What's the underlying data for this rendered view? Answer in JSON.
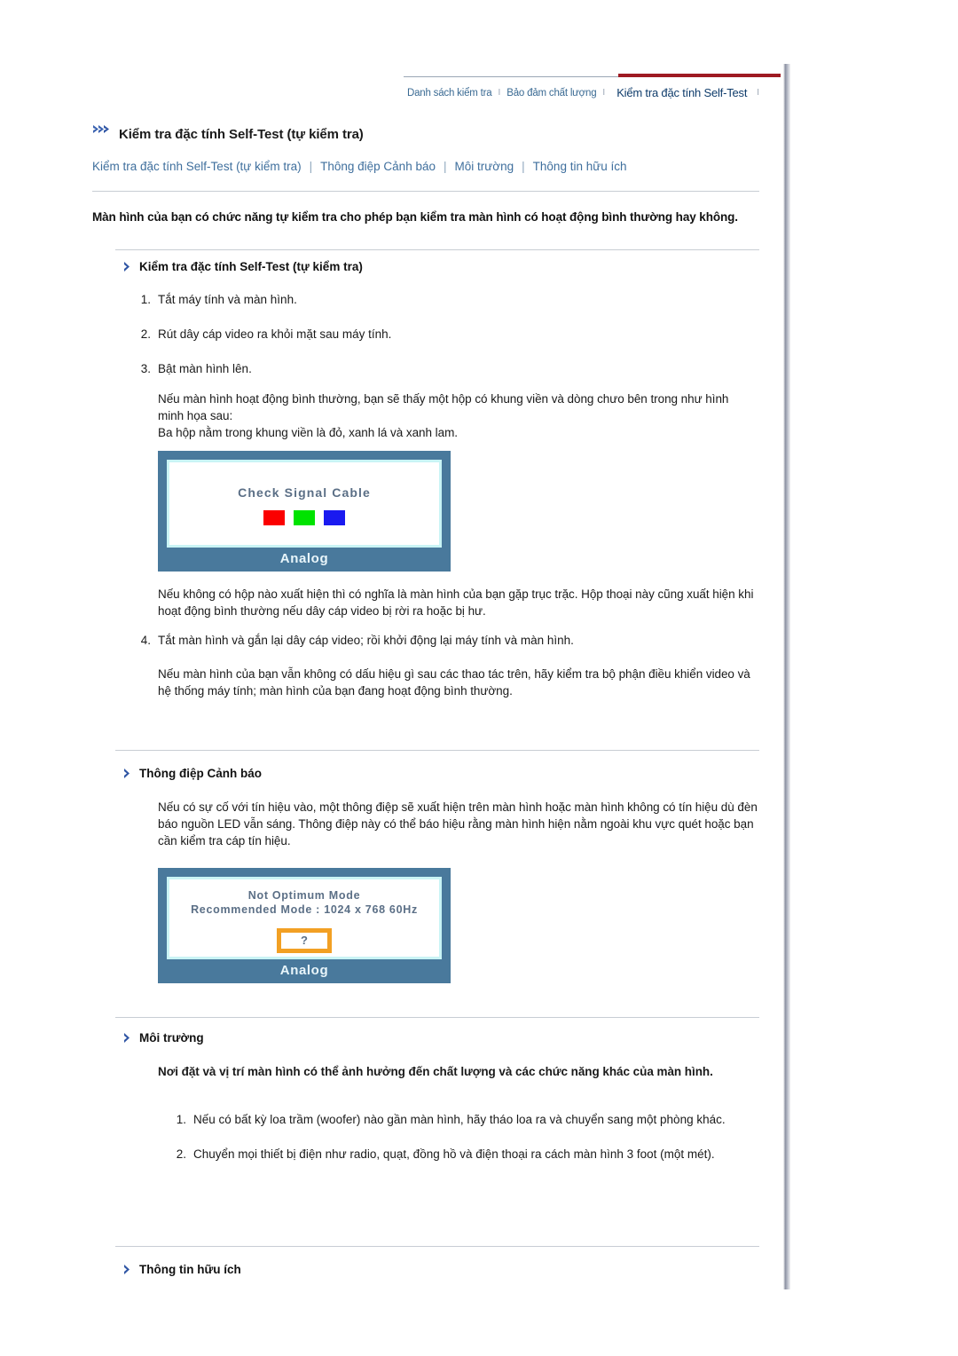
{
  "topnav": {
    "items": [
      {
        "label": "Danh sách kiểm tra",
        "active": false
      },
      {
        "label": "Bảo đảm chất lượng",
        "active": false
      },
      {
        "label": "Kiểm tra đặc tính Self-Test",
        "active": true
      }
    ],
    "separator": "I"
  },
  "page": {
    "title": "Kiểm tra đặc tính Self-Test (tự kiểm tra)"
  },
  "subnav": {
    "links": [
      "Kiểm tra đặc tính Self-Test (tự kiểm tra)",
      "Thông điệp Cảnh báo",
      "Môi trường",
      "Thông tin hữu ích"
    ],
    "separator": "|"
  },
  "lead": "Màn hình của bạn có chức năng tự kiểm tra cho phép bạn kiểm tra màn hình có hoạt động bình thường hay không.",
  "sections": {
    "selftest": {
      "heading": "Kiểm tra đặc tính Self-Test (tự kiểm tra)",
      "steps": [
        {
          "num": "1.",
          "text": "Tắt máy tính và màn hình."
        },
        {
          "num": "2.",
          "text": "Rút dây cáp video ra khỏi mặt sau máy tính."
        },
        {
          "num": "3.",
          "text": "Bật màn hình lên."
        }
      ],
      "normal_note": "Nếu màn hình hoạt động bình thường, bạn sẽ thấy một hộp có khung viền và dòng chưo bên trong như hình minh họa sau:\nBa hộp nằm trong khung viền là đỏ, xanh lá và xanh lam.",
      "monitor": {
        "message": "Check Signal Cable",
        "label": "Analog",
        "swatches": [
          {
            "name": "red",
            "color": "#fb0000"
          },
          {
            "name": "green",
            "color": "#00e300"
          },
          {
            "name": "blue",
            "color": "#1a1af0"
          }
        ]
      },
      "nobox_note": "Nếu không có hộp nào xuất hiện thì có nghĩa là màn hình của bạn gặp trục trặc. Hộp thoại này cũng xuất hiện khi hoạt động bình thường nếu dây cáp video bị rời ra hoặc bị hư.",
      "step4": [
        {
          "num": "4.",
          "text": "Tắt màn hình và gắn lại dây cáp video; rồi khởi động lại máy tính và màn hình."
        }
      ],
      "nosign_note": "Nếu màn hình của bạn vẫn không có dấu hiệu gì sau các thao tác trên, hãy kiểm tra bộ phận điều khiển video và hệ thống máy tính; màn hình của bạn đang hoạt động bình thường."
    },
    "warning": {
      "heading": "Thông điệp Cảnh báo",
      "body": "Nếu có sự cố với tín hiệu vào, một thông điệp sẽ xuất hiện trên màn hình hoặc màn hình không có tín hiệu dù đèn báo nguồn LED vẫn sáng. Thông điệp này có thể báo hiệu rằng màn hình hiện nằm ngoài khu vực quét hoặc bạn cần kiểm tra cáp tín hiệu.",
      "monitor": {
        "line1": "Not Optimum Mode",
        "line2": "Recommended Mode :  1024 x 768   60Hz",
        "question": "?",
        "label": "Analog",
        "box_color": "#f2a024"
      }
    },
    "environment": {
      "heading": "Môi trường",
      "intro": "Nơi đặt và vị trí màn hình có thể ảnh hưởng đến chất lượng và các chức năng khác của màn hình.",
      "steps": [
        {
          "num": "1.",
          "text": "Nếu có bất kỳ loa trầm (woofer) nào gần màn hình, hãy tháo loa ra và chuyển sang một phòng khác."
        },
        {
          "num": "2.",
          "text": "Chuyển mọi thiết bị điện như radio, quạt, đồng hồ và điện thoại ra cách màn hình 3 foot (một mét)."
        }
      ]
    },
    "info": {
      "heading": "Thông tin hữu ích"
    }
  },
  "colors": {
    "accent_red": "#9e1a22",
    "link_blue": "#3f6f9d",
    "nav_blue": "#3a6a93",
    "monitor_frame": "#49799c",
    "monitor_inner": "#c9f4f5",
    "chevron_blue": "#2f55a4"
  }
}
